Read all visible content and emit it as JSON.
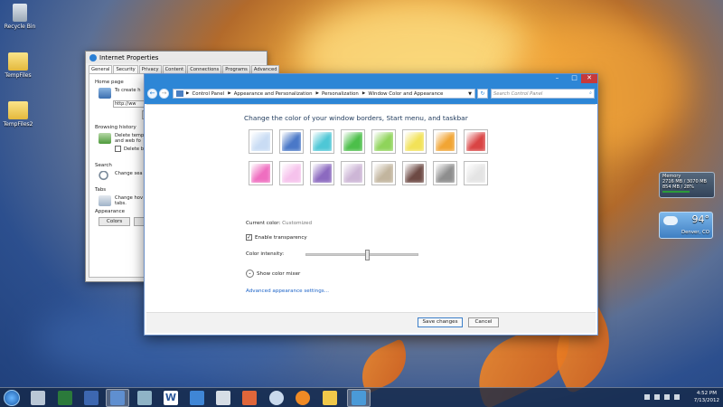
{
  "desktop": {
    "icons": [
      {
        "label": "Recycle Bin"
      },
      {
        "label": "TempFiles"
      },
      {
        "label": "TempFiles2"
      }
    ]
  },
  "internet_properties": {
    "title": "Internet Properties",
    "tabs": [
      "General",
      "Security",
      "Privacy",
      "Content",
      "Connections",
      "Programs",
      "Advanced"
    ],
    "home_page_heading": "Home page",
    "home_page_text": "To create h",
    "home_page_url": "http://ww",
    "use_label": "U",
    "browsing_history_heading": "Browsing history",
    "history_text_1": "Delete temp",
    "history_text_2": "and web fo",
    "delete_on_exit": "Delete b",
    "search_heading": "Search",
    "search_text": "Change sea",
    "tabs_heading": "Tabs",
    "tabs_text_1": "Change hov",
    "tabs_text_2": "tabs.",
    "appearance_heading": "Appearance",
    "colors_button": "Colors"
  },
  "color_window": {
    "window_controls": {
      "minimize": "–",
      "maximize": "□",
      "close": "✕"
    },
    "breadcrumbs": [
      "Control Panel",
      "Appearance and Personalization",
      "Personalization",
      "Window Color and Appearance"
    ],
    "search_placeholder": "Search Control Panel",
    "heading": "Change the color of your window borders, Start menu, and taskbar",
    "swatch_colors": [
      "#c9dcf4",
      "#4a78c8",
      "#4ec7d6",
      "#4cbf4a",
      "#8fd45a",
      "#f2e258",
      "#f1a534",
      "#d94444",
      "#ef6ec0",
      "#f6c2ec",
      "#8c6ac0",
      "#cdb6d6",
      "#c2b59e",
      "#6d4a44",
      "#8e8e8e",
      "#e4e4e4"
    ],
    "current_color_label": "Current color:",
    "current_color_value": "Customized",
    "enable_transparency": "Enable transparency",
    "transparency_checked": "✓",
    "color_intensity_label": "Color intensity:",
    "intensity_value": 0.55,
    "show_color_mixer": "Show color mixer",
    "advanced_link": "Advanced appearance settings...",
    "save_button": "Save changes",
    "cancel_button": "Cancel"
  },
  "gadgets": {
    "memory_title": "Memory",
    "memory_line_1": "2716 MB / 3070 MB",
    "memory_line_2": "854 MB / 28%",
    "memory_fraction": 0.28,
    "temperature": "94°",
    "city": "Denver, CO"
  },
  "taskbar": {
    "time": "4:52 PM",
    "date": "7/13/2012"
  },
  "colors": {
    "accent": "#2d86d6",
    "link": "#1c63c7"
  }
}
